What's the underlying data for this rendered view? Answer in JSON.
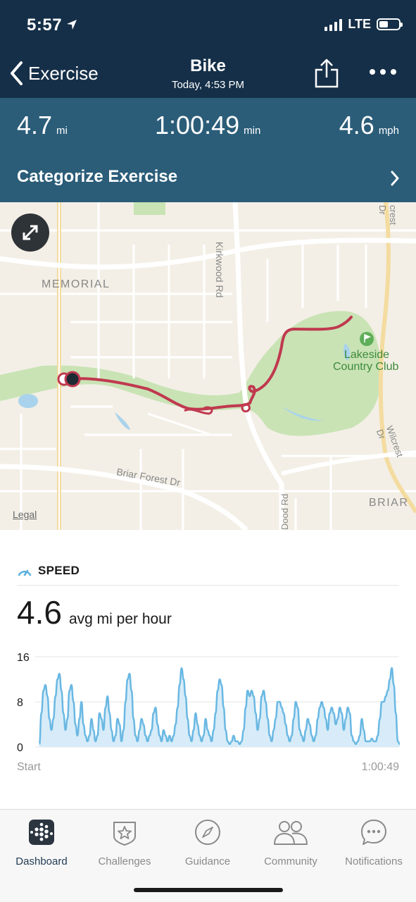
{
  "status_bar": {
    "time": "5:57",
    "network": "LTE",
    "signal_bars": 4,
    "battery_level": 0.45
  },
  "header": {
    "back_label": "Exercise",
    "title": "Bike",
    "subtitle": "Today, 4:53 PM",
    "share_icon": "share-icon",
    "more_icon": "more-dots-icon"
  },
  "stats": {
    "distance": {
      "value": "4.7",
      "unit": "mi"
    },
    "duration": {
      "value": "1:00:49",
      "unit": "min"
    },
    "speed": {
      "value": "4.6",
      "unit": "mph"
    }
  },
  "categorize": {
    "label": "Categorize Exercise"
  },
  "map": {
    "labels": {
      "memorial": "MEMORIAL",
      "kirkwood": "Kirkwood Rd",
      "lakeside": "Lakeside",
      "country_club": "Country Club",
      "briar_forest": "Briar Forest Dr",
      "wilcrest": "Wilcrest Dr",
      "wilcrest_top": "crest Dr",
      "briar": "BRIAR",
      "dood": "Dood Rd"
    },
    "legal": "Legal",
    "route_color": "#c0394f"
  },
  "speed": {
    "title": "SPEED",
    "avg_value": "4.6",
    "avg_label": "avg mi per hour"
  },
  "chart_data": {
    "type": "area",
    "y_ticks": [
      "16",
      "8",
      "0"
    ],
    "ylim": [
      0,
      16
    ],
    "x_start_label": "Start",
    "x_end_label": "1:00:49",
    "color": "#6ab8e3",
    "values": [
      0.5,
      6,
      10,
      11,
      9,
      5,
      3,
      5,
      9,
      12,
      13,
      10,
      6,
      3,
      5,
      10,
      11,
      8,
      4,
      2,
      5,
      8,
      4,
      2,
      1,
      2,
      5,
      3,
      1,
      2,
      6,
      5,
      3,
      7,
      9,
      6,
      3,
      1,
      2,
      5,
      4,
      1,
      3,
      8,
      12,
      13,
      10,
      5,
      2,
      1,
      3,
      5,
      4,
      2,
      1,
      2,
      3,
      6,
      7,
      4,
      2,
      1,
      3,
      2,
      1,
      2,
      1,
      2,
      4,
      7,
      11,
      14,
      12,
      9,
      5,
      2,
      1,
      3,
      6,
      4,
      2,
      1,
      2,
      5,
      3,
      2,
      1,
      3,
      6,
      10,
      12,
      11,
      7,
      3,
      1,
      0.5,
      1,
      2,
      1,
      1,
      0.5,
      1,
      3,
      7,
      10,
      9,
      10,
      9,
      6,
      3,
      5,
      9,
      10,
      8,
      5,
      2,
      1,
      3,
      5,
      8,
      8,
      7,
      6,
      4,
      2,
      1,
      2,
      5,
      8,
      7,
      3,
      2,
      1,
      3,
      5,
      4,
      2,
      1,
      2,
      5,
      7,
      8,
      7,
      5,
      3,
      6,
      7,
      6,
      4,
      5,
      7,
      6,
      3,
      5,
      7,
      6,
      2,
      1,
      0.5,
      1,
      2,
      5,
      3,
      1,
      1,
      1,
      1.5,
      1,
      1,
      2,
      5,
      8,
      8,
      9,
      10,
      12,
      14,
      11,
      6,
      1,
      0.5
    ]
  },
  "tabs": [
    {
      "label": "Dashboard",
      "icon": "dashboard-grid-icon",
      "active": true
    },
    {
      "label": "Challenges",
      "icon": "star-shield-icon",
      "active": false
    },
    {
      "label": "Guidance",
      "icon": "compass-icon",
      "active": false
    },
    {
      "label": "Community",
      "icon": "people-icon",
      "active": false
    },
    {
      "label": "Notifications",
      "icon": "chat-bubble-icon",
      "active": false
    }
  ]
}
